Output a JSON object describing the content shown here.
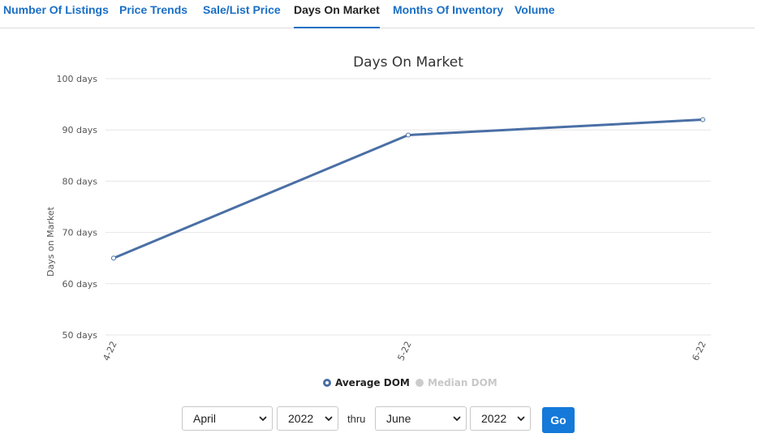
{
  "tabs": [
    {
      "label": "Number Of Listings",
      "active": false
    },
    {
      "label": "Price Trends",
      "active": false
    },
    {
      "label": "Sale/List Price",
      "active": false
    },
    {
      "label": "Days On Market",
      "active": true
    },
    {
      "label": "Months Of Inventory",
      "active": false
    },
    {
      "label": "Volume",
      "active": false
    }
  ],
  "chart_data": {
    "type": "line",
    "title": "Days On Market",
    "xlabel": "",
    "ylabel": "Days on Market",
    "categories": [
      "4-22",
      "5-22",
      "6-22"
    ],
    "ylim": [
      50,
      100
    ],
    "yticks": [
      50,
      60,
      70,
      80,
      90,
      100
    ],
    "ytick_suffix": " days",
    "grid": true,
    "legend_position": "bottom",
    "series": [
      {
        "name": "Average DOM",
        "values": [
          65,
          89,
          92
        ],
        "color": "#4a6fa5",
        "visible": true
      },
      {
        "name": "Median DOM",
        "values": [],
        "color": "#cccccc",
        "visible": false
      }
    ]
  },
  "controls": {
    "start_month": "April",
    "start_year": "2022",
    "thru_label": "thru",
    "end_month": "June",
    "end_year": "2022",
    "go_label": "Go"
  }
}
